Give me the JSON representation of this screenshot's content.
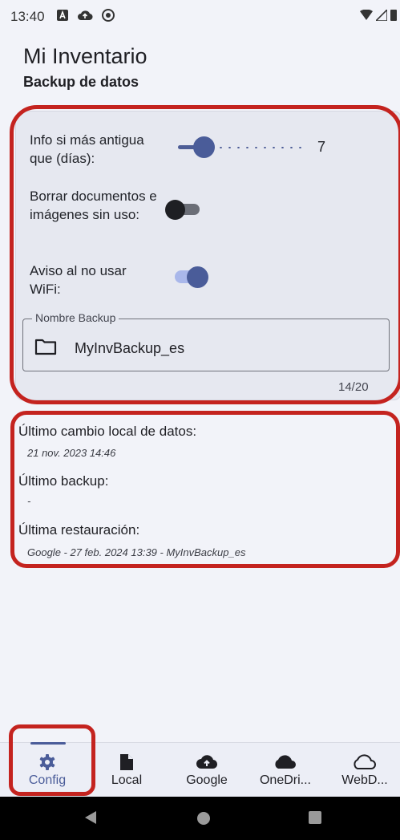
{
  "status_bar": {
    "time": "13:40"
  },
  "app": {
    "title": "Mi Inventario",
    "subtitle": "Backup de datos"
  },
  "settings": {
    "age_label": "Info si más antigua que (días):",
    "age_value": "7",
    "age_level_fraction": 0.25,
    "delete_label": "Borrar documentos e imágenes sin uso:",
    "delete_on": false,
    "wifi_label": "Aviso al no usar WiFi:",
    "wifi_on": true,
    "backup_name_label": "Nombre Backup",
    "backup_name_value": "MyInvBackup_es",
    "backup_name_counter": "14/20"
  },
  "info": {
    "last_local_change_label": "Último cambio local de datos:",
    "last_local_change_value": "21 nov. 2023 14:46",
    "last_backup_label": "Último backup:",
    "last_backup_value": "-",
    "last_restore_label": "Última restauración:",
    "last_restore_value": "Google - 27 feb. 2024 13:39 - MyInvBackup_es"
  },
  "nav": {
    "items": [
      {
        "label": "Config",
        "icon": "gear-icon",
        "selected": true
      },
      {
        "label": "Local",
        "icon": "document-icon",
        "selected": false
      },
      {
        "label": "Google",
        "icon": "cloud-upload-icon",
        "selected": false
      },
      {
        "label": "OneDri...",
        "icon": "cloud-filled-icon",
        "selected": false
      },
      {
        "label": "WebD...",
        "icon": "cloud-outline-icon",
        "selected": false
      }
    ]
  },
  "colors": {
    "accent": "#4a5c99",
    "highlight_box": "#c4231f",
    "background": "#f2f3f9"
  }
}
